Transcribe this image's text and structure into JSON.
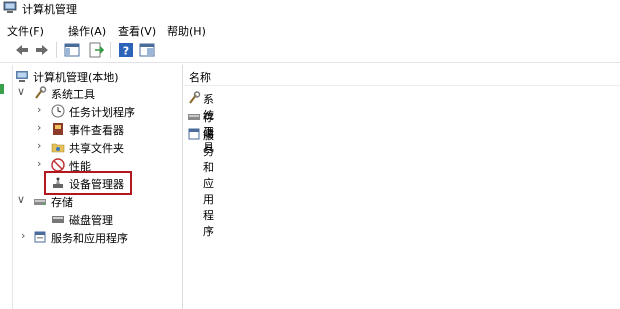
{
  "window": {
    "title": "计算机管理"
  },
  "menu": [
    {
      "label": "文件(F)"
    },
    {
      "label": "操作(A)"
    },
    {
      "label": "查看(V)"
    },
    {
      "label": "帮助(H)"
    }
  ],
  "toolbar": {
    "icons": [
      "back-icon",
      "forward-icon",
      "show-hide-tree-icon",
      "export-list-icon",
      "help-icon",
      "properties-icon"
    ]
  },
  "tree": {
    "root": "计算机管理(本地)",
    "system_tools": "系统工具",
    "task_scheduler": "任务计划程序",
    "event_viewer": "事件查看器",
    "shared_folders": "共享文件夹",
    "performance": "性能",
    "device_manager": "设备管理器",
    "storage": "存储",
    "disk_management": "磁盘管理",
    "services_apps": "服务和应用程序"
  },
  "content": {
    "column_header": "名称",
    "items": [
      {
        "label": "系统工具"
      },
      {
        "label": "存储"
      },
      {
        "label": "服务和应用程序"
      }
    ]
  },
  "colors": {
    "highlight": "#b0181d"
  }
}
